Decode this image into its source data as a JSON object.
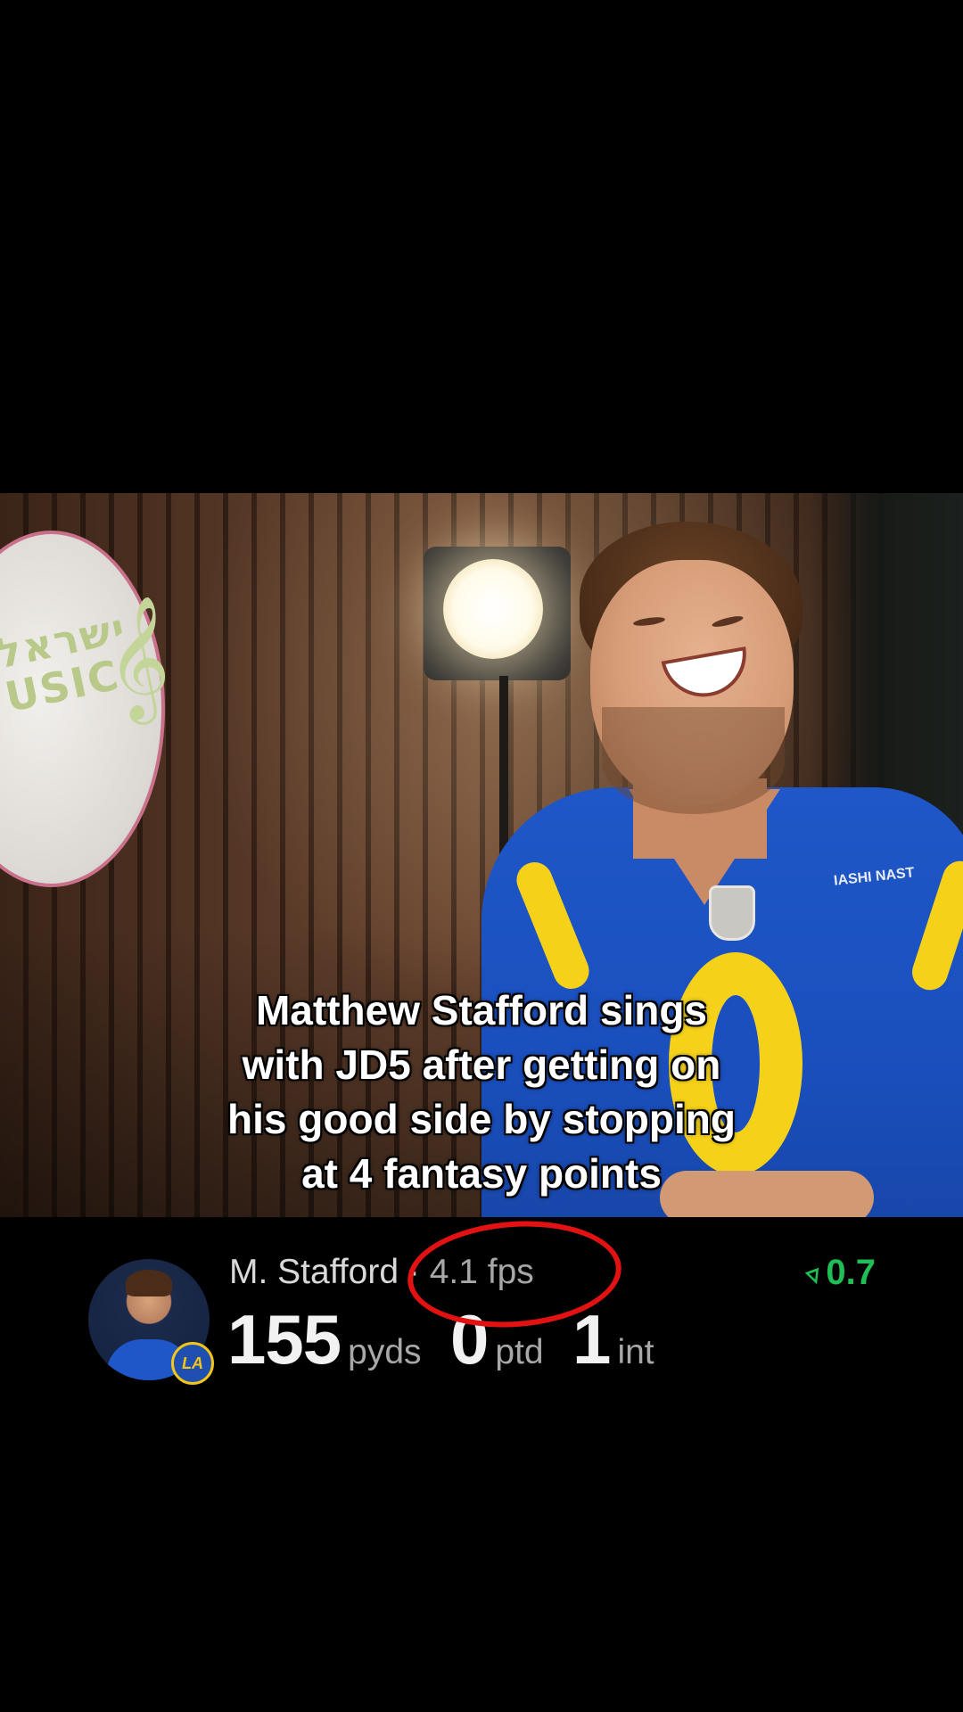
{
  "video": {
    "caption": "Matthew Stafford sings\nwith JD5 after getting on\nhis good side by stopping\nat 4 fantasy points",
    "sign_text": "ישראל\nUSIC",
    "jersey_text": "IASHI NAST"
  },
  "stats_bar": {
    "player_name": "M. Stafford",
    "separator": " · ",
    "fantasy_points": "4.1 fps",
    "trend_icon": "trend-down-arrow-icon",
    "trend_value": "0.7",
    "trend_color": "#1fbf55",
    "team_logo_text": "LA",
    "stats": [
      {
        "value": "155",
        "unit": "pyds"
      },
      {
        "value": "0",
        "unit": "ptd"
      },
      {
        "value": "1",
        "unit": "int"
      }
    ]
  },
  "annotation": {
    "color": "#e31212",
    "shape": "ellipse-around-fps"
  }
}
